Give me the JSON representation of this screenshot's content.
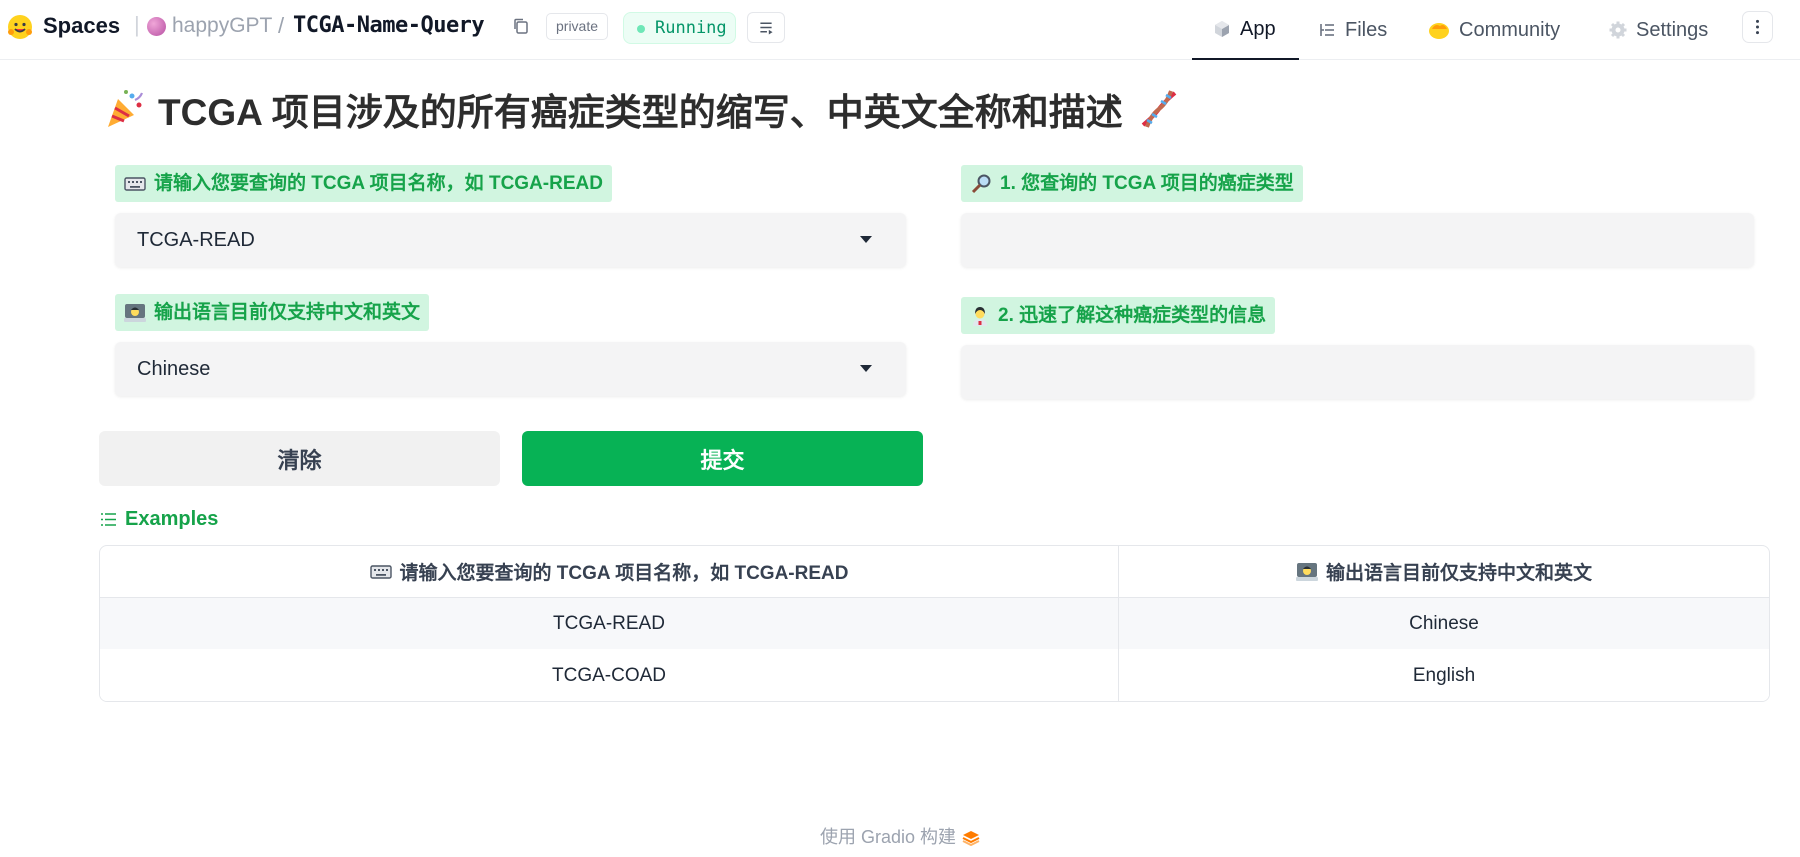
{
  "topbar": {
    "spaces_label": "Spaces",
    "owner": "happyGPT",
    "separator": "/",
    "repo": "TCGA-Name-Query",
    "visibility": "private",
    "status": "Running",
    "tabs": [
      {
        "label": "App",
        "icon": "cube-icon",
        "active": true
      },
      {
        "label": "Files",
        "icon": "files-icon",
        "active": false
      },
      {
        "label": "Community",
        "icon": "community-icon",
        "active": false
      },
      {
        "label": "Settings",
        "icon": "gear-icon",
        "active": false
      }
    ]
  },
  "main": {
    "title": "TCGA 项目涉及的所有癌症类型的缩写、中英文全称和描述",
    "title_icons": [
      "party-popper-icon",
      "dna-icon"
    ],
    "input_project": {
      "label": "请输入您要查询的 TCGA 项目名称，如 TCGA-READ",
      "icon": "keyboard-icon",
      "value": "TCGA-READ"
    },
    "input_language": {
      "label": "输出语言目前仅支持中文和英文",
      "icon": "technologist-icon",
      "value": "Chinese"
    },
    "output_cancer_type": {
      "label": "1. 您查询的 TCGA 项目的癌症类型",
      "icon": "magnifier-icon",
      "value": ""
    },
    "output_info": {
      "label": "2. 迅速了解这种癌症类型的信息",
      "icon": "health-worker-icon",
      "value": ""
    },
    "buttons": {
      "clear": "清除",
      "submit": "提交"
    }
  },
  "examples": {
    "heading": "Examples",
    "headers": [
      "请输入您要查询的 TCGA 项目名称，如 TCGA-READ",
      "输出语言目前仅支持中文和英文"
    ],
    "rows": [
      [
        "TCGA-READ",
        "Chinese"
      ],
      [
        "TCGA-COAD",
        "English"
      ]
    ]
  },
  "footer": {
    "text": "使用 Gradio 构建"
  },
  "colors": {
    "accent_green": "#07b255",
    "label_bg": "#d1f5e0",
    "label_text": "#16a34a"
  }
}
